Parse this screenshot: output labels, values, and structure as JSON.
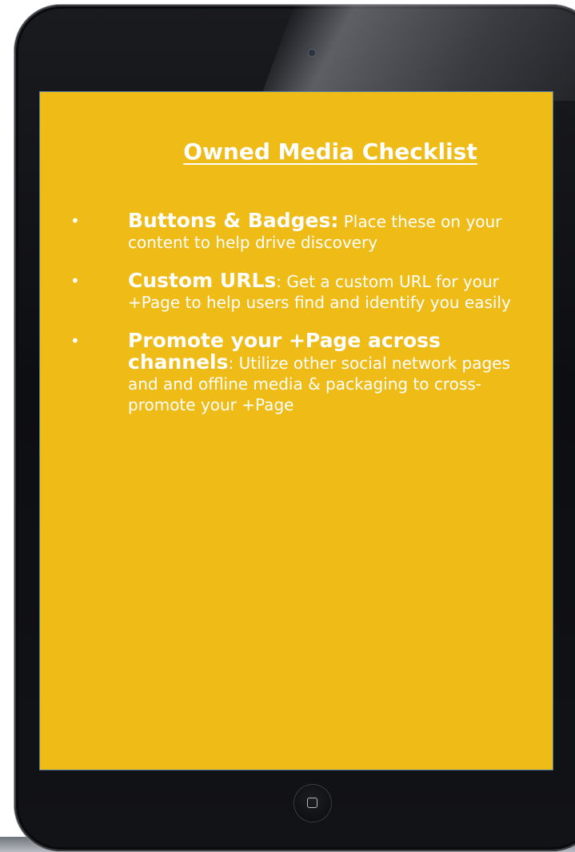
{
  "title": "Owned Media Checklist",
  "items": [
    {
      "bullet": "•",
      "head": "Buttons & Badges:",
      "text": " Place these on your content to help drive discovery"
    },
    {
      "bullet": "•",
      "head": "Custom URLs",
      "text": ": Get a custom URL for your +Page to help users find and identify you easily"
    },
    {
      "bullet": "•",
      "head": "Promote your +Page across channels",
      "text": ": Utilize other social network pages and and offline media & packaging to cross-promote your +Page"
    }
  ],
  "colors": {
    "screen": "#efbb17",
    "device": "#111216",
    "text": "#ffffff"
  },
  "icons": {
    "home": "home-button-icon",
    "camera": "front-camera-icon"
  }
}
